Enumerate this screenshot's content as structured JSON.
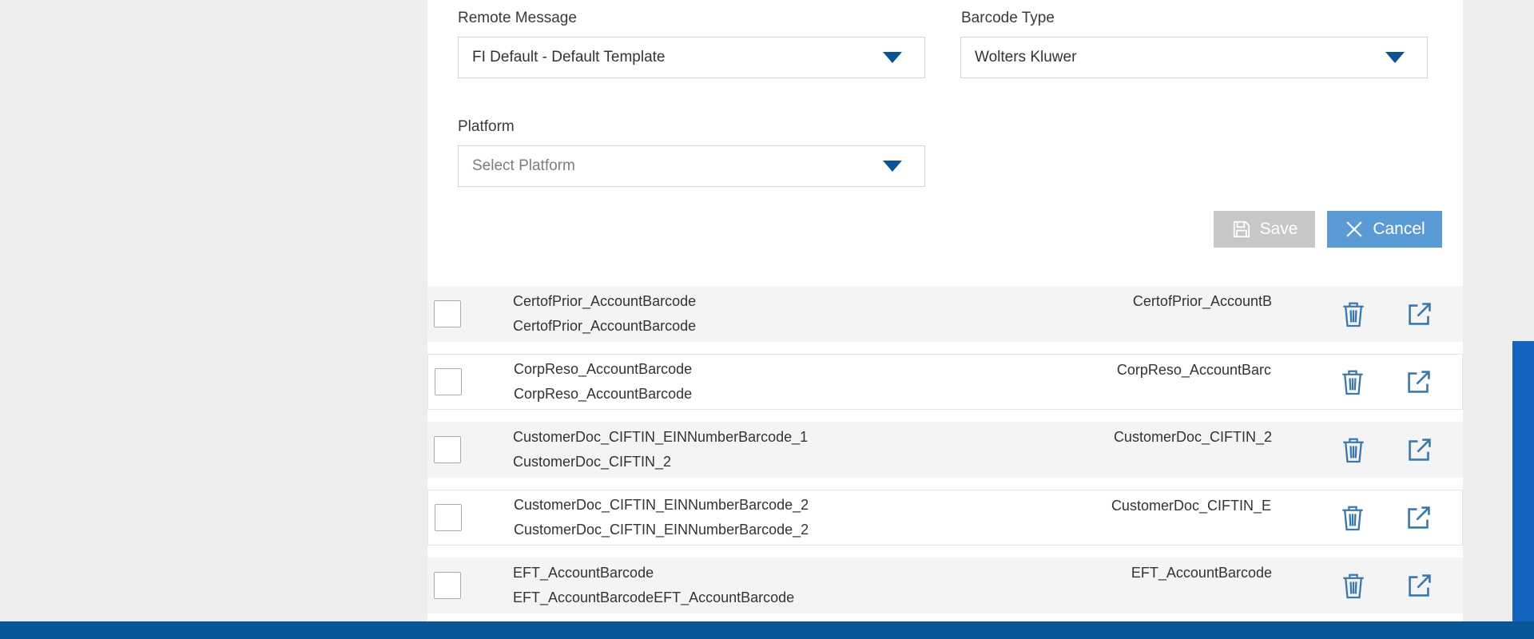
{
  "form": {
    "remote_message_label": "Remote Message",
    "remote_message_value": "FI Default - Default Template",
    "barcode_type_label": "Barcode Type",
    "barcode_type_value": "Wolters Kluwer",
    "platform_label": "Platform",
    "platform_placeholder": "Select Platform"
  },
  "buttons": {
    "save": "Save",
    "cancel": "Cancel"
  },
  "list": {
    "rows": [
      {
        "name": "CertofPrior_AccountBarcode",
        "subname": "CertofPrior_AccountBarcode",
        "right": "CertofPrior_AccountB"
      },
      {
        "name": "CorpReso_AccountBarcode",
        "subname": "CorpReso_AccountBarcode",
        "right": "CorpReso_AccountBarc"
      },
      {
        "name": "CustomerDoc_CIFTIN_EINNumberBarcode_1",
        "subname": "CustomerDoc_CIFTIN_2",
        "right": "CustomerDoc_CIFTIN_2"
      },
      {
        "name": "CustomerDoc_CIFTIN_EINNumberBarcode_2",
        "subname": "CustomerDoc_CIFTIN_EINNumberBarcode_2",
        "right": "CustomerDoc_CIFTIN_E"
      },
      {
        "name": "EFT_AccountBarcode",
        "subname": "EFT_AccountBarcodeEFT_AccountBarcode",
        "right": "EFT_AccountBarcode"
      }
    ]
  },
  "icons": {
    "dropdown_arrow": "triangle-down",
    "save": "floppy-disk",
    "cancel": "x-cross",
    "delete": "trash-can",
    "open": "open-in-new"
  },
  "colors": {
    "accent_blue": "#0b5394",
    "cancel_blue": "#5b9bd5",
    "icon_blue": "#3a78ae",
    "footer_blue": "#0a5796",
    "scrollbar_blue": "#1565c0",
    "disabled_gray": "#c7c7c7",
    "stripe_gray": "#f4f4f4",
    "page_gray": "#ededed"
  }
}
